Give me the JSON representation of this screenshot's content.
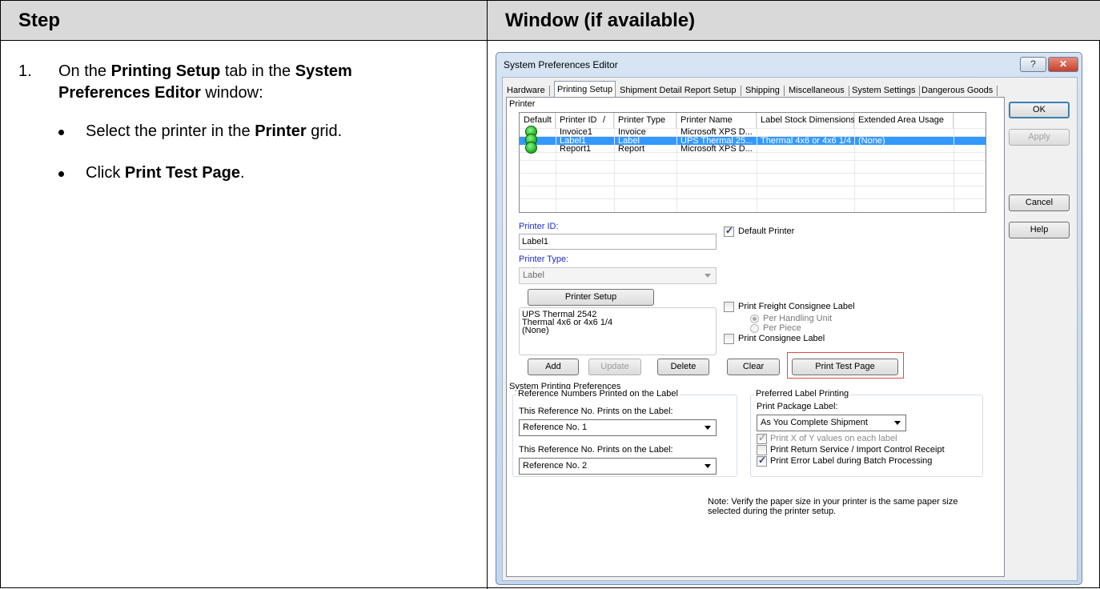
{
  "table": {
    "col1_header": "Step",
    "col2_header": "Window (if available)"
  },
  "step": {
    "number": "1.",
    "pre1": "On the ",
    "tab_name": "Printing Setup",
    "mid1": " tab in the ",
    "window_name_1": "System",
    "window_name_2": "Preferences Editor",
    "post1": " window:",
    "bullet1_pre": "Select the printer in the ",
    "bullet1_bold": "Printer",
    "bullet1_post": " grid.",
    "bullet2_pre": "Click ",
    "bullet2_bold": "Print Test Page",
    "bullet2_post": "."
  },
  "dialog": {
    "title": "System Preferences Editor",
    "help_btn": "?",
    "close_btn": "✕",
    "tabs": [
      "Hardware",
      "Printing Setup",
      "Shipment Detail Report Setup",
      "Shipping",
      "Miscellaneous",
      "System Settings",
      "Dangerous Goods"
    ],
    "printer_group_label": "Printer",
    "grid_headers": [
      "Default",
      "Printer ID",
      "/",
      "Printer Type",
      "Printer Name",
      "Label Stock Dimensions",
      "Extended Area Usage"
    ],
    "grid_rows": [
      {
        "id": "Invoice1",
        "type": "Invoice",
        "name": "Microsoft XPS D...",
        "stock": "",
        "area": ""
      },
      {
        "id": "Label1",
        "type": "Label",
        "name": "UPS Thermal 25...",
        "stock": "Thermal 4x6 or 4x6 1/4",
        "area": "(None)"
      },
      {
        "id": "Report1",
        "type": "Report",
        "name": "Microsoft XPS D...",
        "stock": "",
        "area": ""
      }
    ],
    "printer_id_label": "Printer ID:",
    "printer_id_value": "Label1",
    "default_printer_label": "Default Printer",
    "printer_type_label": "Printer Type:",
    "printer_type_value": "Label",
    "printer_setup_btn": "Printer Setup",
    "printer_info": [
      "UPS Thermal 2542",
      "Thermal 4x6 or 4x6 1/4",
      "(None)"
    ],
    "print_freight_label": "Print Freight Consignee Label",
    "per_handling_unit": "Per Handling Unit",
    "per_piece": "Per Piece",
    "print_consignee_label": "Print Consignee Label",
    "add_btn": "Add",
    "update_btn": "Update",
    "delete_btn": "Delete",
    "clear_btn": "Clear",
    "print_test_btn": "Print Test Page",
    "sys_print_prefs": "System Printing Preferences",
    "ref_group": "Reference Numbers Printed on the Label",
    "ref1_label": "This Reference No. Prints on the Label:",
    "ref1_value": "Reference No. 1",
    "ref2_label": "This Reference No. Prints on the Label:",
    "ref2_value": "Reference No. 2",
    "pref_label_group": "Preferred Label Printing",
    "print_pkg_label": "Print Package Label:",
    "print_pkg_value": "As You Complete Shipment",
    "print_x_of_y": "Print X of Y values on each label",
    "print_return": "Print Return Service / Import Control Receipt",
    "print_error": "Print Error Label during Batch Processing",
    "note_line1": "Note: Verify the paper size in your printer is the same paper size",
    "note_line2": "selected during the printer setup.",
    "ok_btn": "OK",
    "apply_btn": "Apply",
    "cancel_btn": "Cancel",
    "help_side_btn": "Help"
  }
}
